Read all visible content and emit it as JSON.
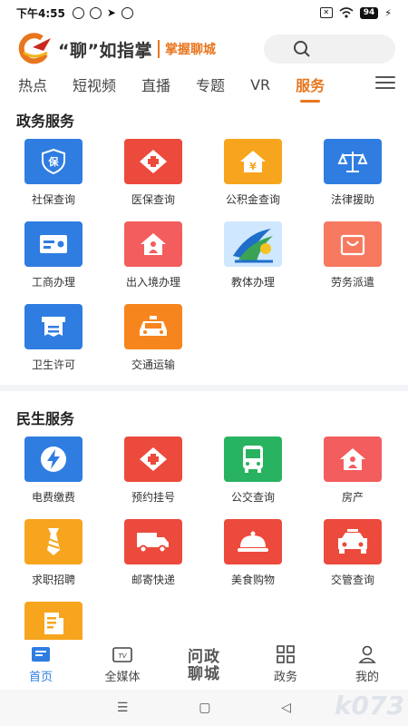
{
  "status_bar": {
    "time": "下午4:55",
    "battery": "94"
  },
  "header": {
    "slogan": "“聊”如指掌",
    "brand": "掌握聊城"
  },
  "tabs": [
    {
      "label": "热点"
    },
    {
      "label": "短视频"
    },
    {
      "label": "直播"
    },
    {
      "label": "专题"
    },
    {
      "label": "VR"
    },
    {
      "label": "服务",
      "active": true
    }
  ],
  "sections": {
    "gov": {
      "title": "政务服务",
      "items": [
        {
          "label": "社保查询",
          "icon": "shield-icon",
          "color": "#2f7de1"
        },
        {
          "label": "医保查询",
          "icon": "medical-cross-icon",
          "color": "#ec4a3c"
        },
        {
          "label": "公积金查询",
          "icon": "house-yuan-icon",
          "color": "#f7a51e"
        },
        {
          "label": "法律援助",
          "icon": "scales-icon",
          "color": "#2f7de1"
        },
        {
          "label": "工商办理",
          "icon": "id-card-icon",
          "color": "#2f7de1"
        },
        {
          "label": "出入境办理",
          "icon": "home-person-icon",
          "color": "#f35d5d"
        },
        {
          "label": "教体办理",
          "icon": "education-logo-icon",
          "color": "#cfe7ff"
        },
        {
          "label": "劳务派遣",
          "icon": "shopping-bag-icon",
          "color": "#f7795f"
        },
        {
          "label": "卫生许可",
          "icon": "certificate-icon",
          "color": "#2f7de1"
        },
        {
          "label": "交通运输",
          "icon": "taxi-icon",
          "color": "#f7851e"
        }
      ]
    },
    "life": {
      "title": "民生服务",
      "items": [
        {
          "label": "电费缴费",
          "icon": "lightning-icon",
          "color": "#2f7de1"
        },
        {
          "label": "预约挂号",
          "icon": "medical-cross-icon",
          "color": "#ec4a3c"
        },
        {
          "label": "公交查询",
          "icon": "bus-icon",
          "color": "#27b360"
        },
        {
          "label": "房产",
          "icon": "home-person-icon",
          "color": "#f35d5d"
        },
        {
          "label": "求职招聘",
          "icon": "tie-icon",
          "color": "#f7a51e"
        },
        {
          "label": "邮寄快递",
          "icon": "truck-icon",
          "color": "#ec4a3c"
        },
        {
          "label": "美食购物",
          "icon": "food-cloche-icon",
          "color": "#ec4a3c"
        },
        {
          "label": "交管查询",
          "icon": "car-icon",
          "color": "#ec4a3c"
        },
        {
          "label": "",
          "icon": "document-icon",
          "color": "#f7a51e"
        }
      ]
    }
  },
  "bottom_nav": [
    {
      "label": "首页",
      "icon": "home-icon",
      "active": true
    },
    {
      "label": "全媒体",
      "icon": "tv-icon"
    },
    {
      "label": "问政聊城",
      "icon": "center-logo"
    },
    {
      "label": "政务",
      "icon": "grid-icon"
    },
    {
      "label": "我的",
      "icon": "user-icon"
    }
  ],
  "watermark": "k073"
}
